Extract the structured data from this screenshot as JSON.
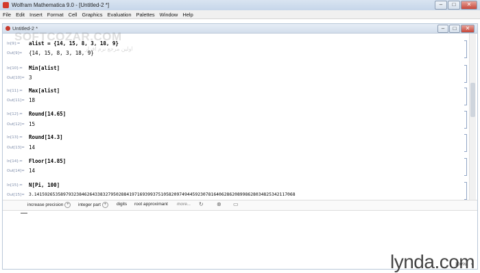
{
  "app": {
    "title": "Wolfram Mathematica 9.0 - [Untitled-2 *]",
    "accent": "#d33a2c"
  },
  "window_buttons": {
    "minimize": "–",
    "maximize": "□",
    "close": "✕"
  },
  "menu": [
    "File",
    "Edit",
    "Insert",
    "Format",
    "Cell",
    "Graphics",
    "Evaluation",
    "Palettes",
    "Window",
    "Help"
  ],
  "notebook": {
    "title": "Untitled-2 *",
    "watermark": "SOFTCOZAR.COM",
    "watermark_sub": "اولین مرجع نرم افزار"
  },
  "cells": [
    {
      "in_label": "In[9]:=",
      "input": "alist = {14, 15, 8, 3, 18, 9}",
      "out_label": "Out[9]=",
      "output": "{14, 15, 8, 3, 18, 9}"
    },
    {
      "in_label": "In[10]:=",
      "input": "Min[alist]",
      "out_label": "Out[10]=",
      "output": "3"
    },
    {
      "in_label": "In[11]:=",
      "input": "Max[alist]",
      "out_label": "Out[11]=",
      "output": "18"
    },
    {
      "in_label": "In[12]:=",
      "input": "Round[14.65]",
      "out_label": "Out[12]=",
      "output": "15"
    },
    {
      "in_label": "In[13]:=",
      "input": "Round[14.3]",
      "out_label": "Out[13]=",
      "output": "14"
    },
    {
      "in_label": "In[14]:=",
      "input": "Floor[14.85]",
      "out_label": "Out[14]=",
      "output": "14"
    },
    {
      "in_label": "In[15]:=",
      "input": "N[Pi, 100]",
      "out_label": "Out[15]=",
      "output": "3.141592653589793238462643383279502884197169399375105820974944592307816406286208998628034825342117068"
    }
  ],
  "suggestions": {
    "items": [
      "increase precision",
      "integer part",
      "digits",
      "root approximant"
    ],
    "more": "more..."
  },
  "branding": {
    "logo": "lynda.com"
  },
  "status": {
    "zoom": "100%"
  }
}
